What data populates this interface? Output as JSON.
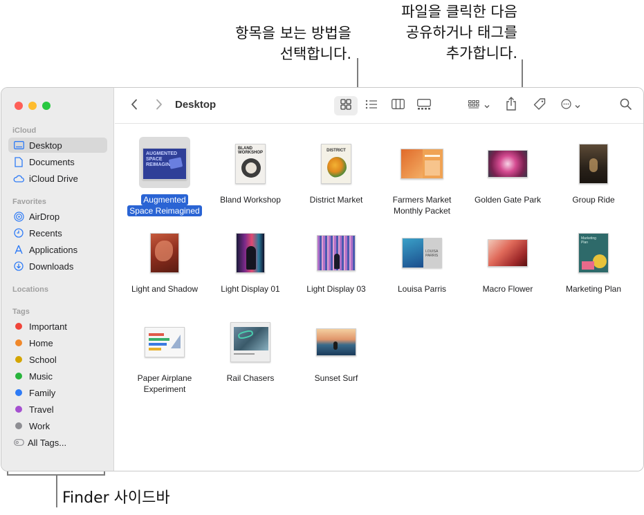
{
  "annotations": {
    "views_line1": "항목을 보는 방법을",
    "views_line2": "선택합니다.",
    "share_line1": "파일을 클릭한 다음",
    "share_line2": "공유하거나 태그를",
    "share_line3": "추가합니다.",
    "sidebar": "Finder 사이드바"
  },
  "window": {
    "title": "Desktop"
  },
  "sidebar": {
    "icloud_header": "iCloud",
    "icloud_items": [
      {
        "label": "Desktop",
        "icon": "desktop-icon",
        "selected": true
      },
      {
        "label": "Documents",
        "icon": "document-icon"
      },
      {
        "label": "iCloud Drive",
        "icon": "cloud-icon"
      }
    ],
    "favorites_header": "Favorites",
    "favorites_items": [
      {
        "label": "AirDrop",
        "icon": "airdrop-icon"
      },
      {
        "label": "Recents",
        "icon": "clock-icon"
      },
      {
        "label": "Applications",
        "icon": "applications-icon"
      },
      {
        "label": "Downloads",
        "icon": "download-icon"
      }
    ],
    "locations_header": "Locations",
    "tags_header": "Tags",
    "tags": [
      {
        "label": "Important",
        "color": "#f0453a"
      },
      {
        "label": "Home",
        "color": "#f0882a"
      },
      {
        "label": "School",
        "color": "#d4a500"
      },
      {
        "label": "Music",
        "color": "#28b43c"
      },
      {
        "label": "Family",
        "color": "#2e7bf6"
      },
      {
        "label": "Travel",
        "color": "#a550d0"
      },
      {
        "label": "Work",
        "color": "#8e8e93"
      }
    ],
    "all_tags": "All Tags..."
  },
  "files": [
    {
      "line1": "Augmented",
      "line2": "Space Reimagined",
      "selected": true
    },
    {
      "line1": "Bland Workshop",
      "line2": ""
    },
    {
      "line1": "District Market",
      "line2": ""
    },
    {
      "line1": "Farmers Market",
      "line2": "Monthly Packet"
    },
    {
      "line1": "Golden Gate Park",
      "line2": ""
    },
    {
      "line1": "Group Ride",
      "line2": ""
    },
    {
      "line1": "Light and Shadow",
      "line2": ""
    },
    {
      "line1": "Light Display 01",
      "line2": ""
    },
    {
      "line1": "Light Display 03",
      "line2": ""
    },
    {
      "line1": "Louisa Parris",
      "line2": ""
    },
    {
      "line1": "Macro Flower",
      "line2": ""
    },
    {
      "line1": "Marketing Plan",
      "line2": ""
    },
    {
      "line1": "Paper Airplane",
      "line2": "Experiment"
    },
    {
      "line1": "Rail Chasers",
      "line2": ""
    },
    {
      "line1": "Sunset Surf",
      "line2": ""
    }
  ],
  "colors": {
    "accent": "#2a64d4",
    "sidebar_bg": "#ececec",
    "icon_blue": "#2e7bf6"
  }
}
